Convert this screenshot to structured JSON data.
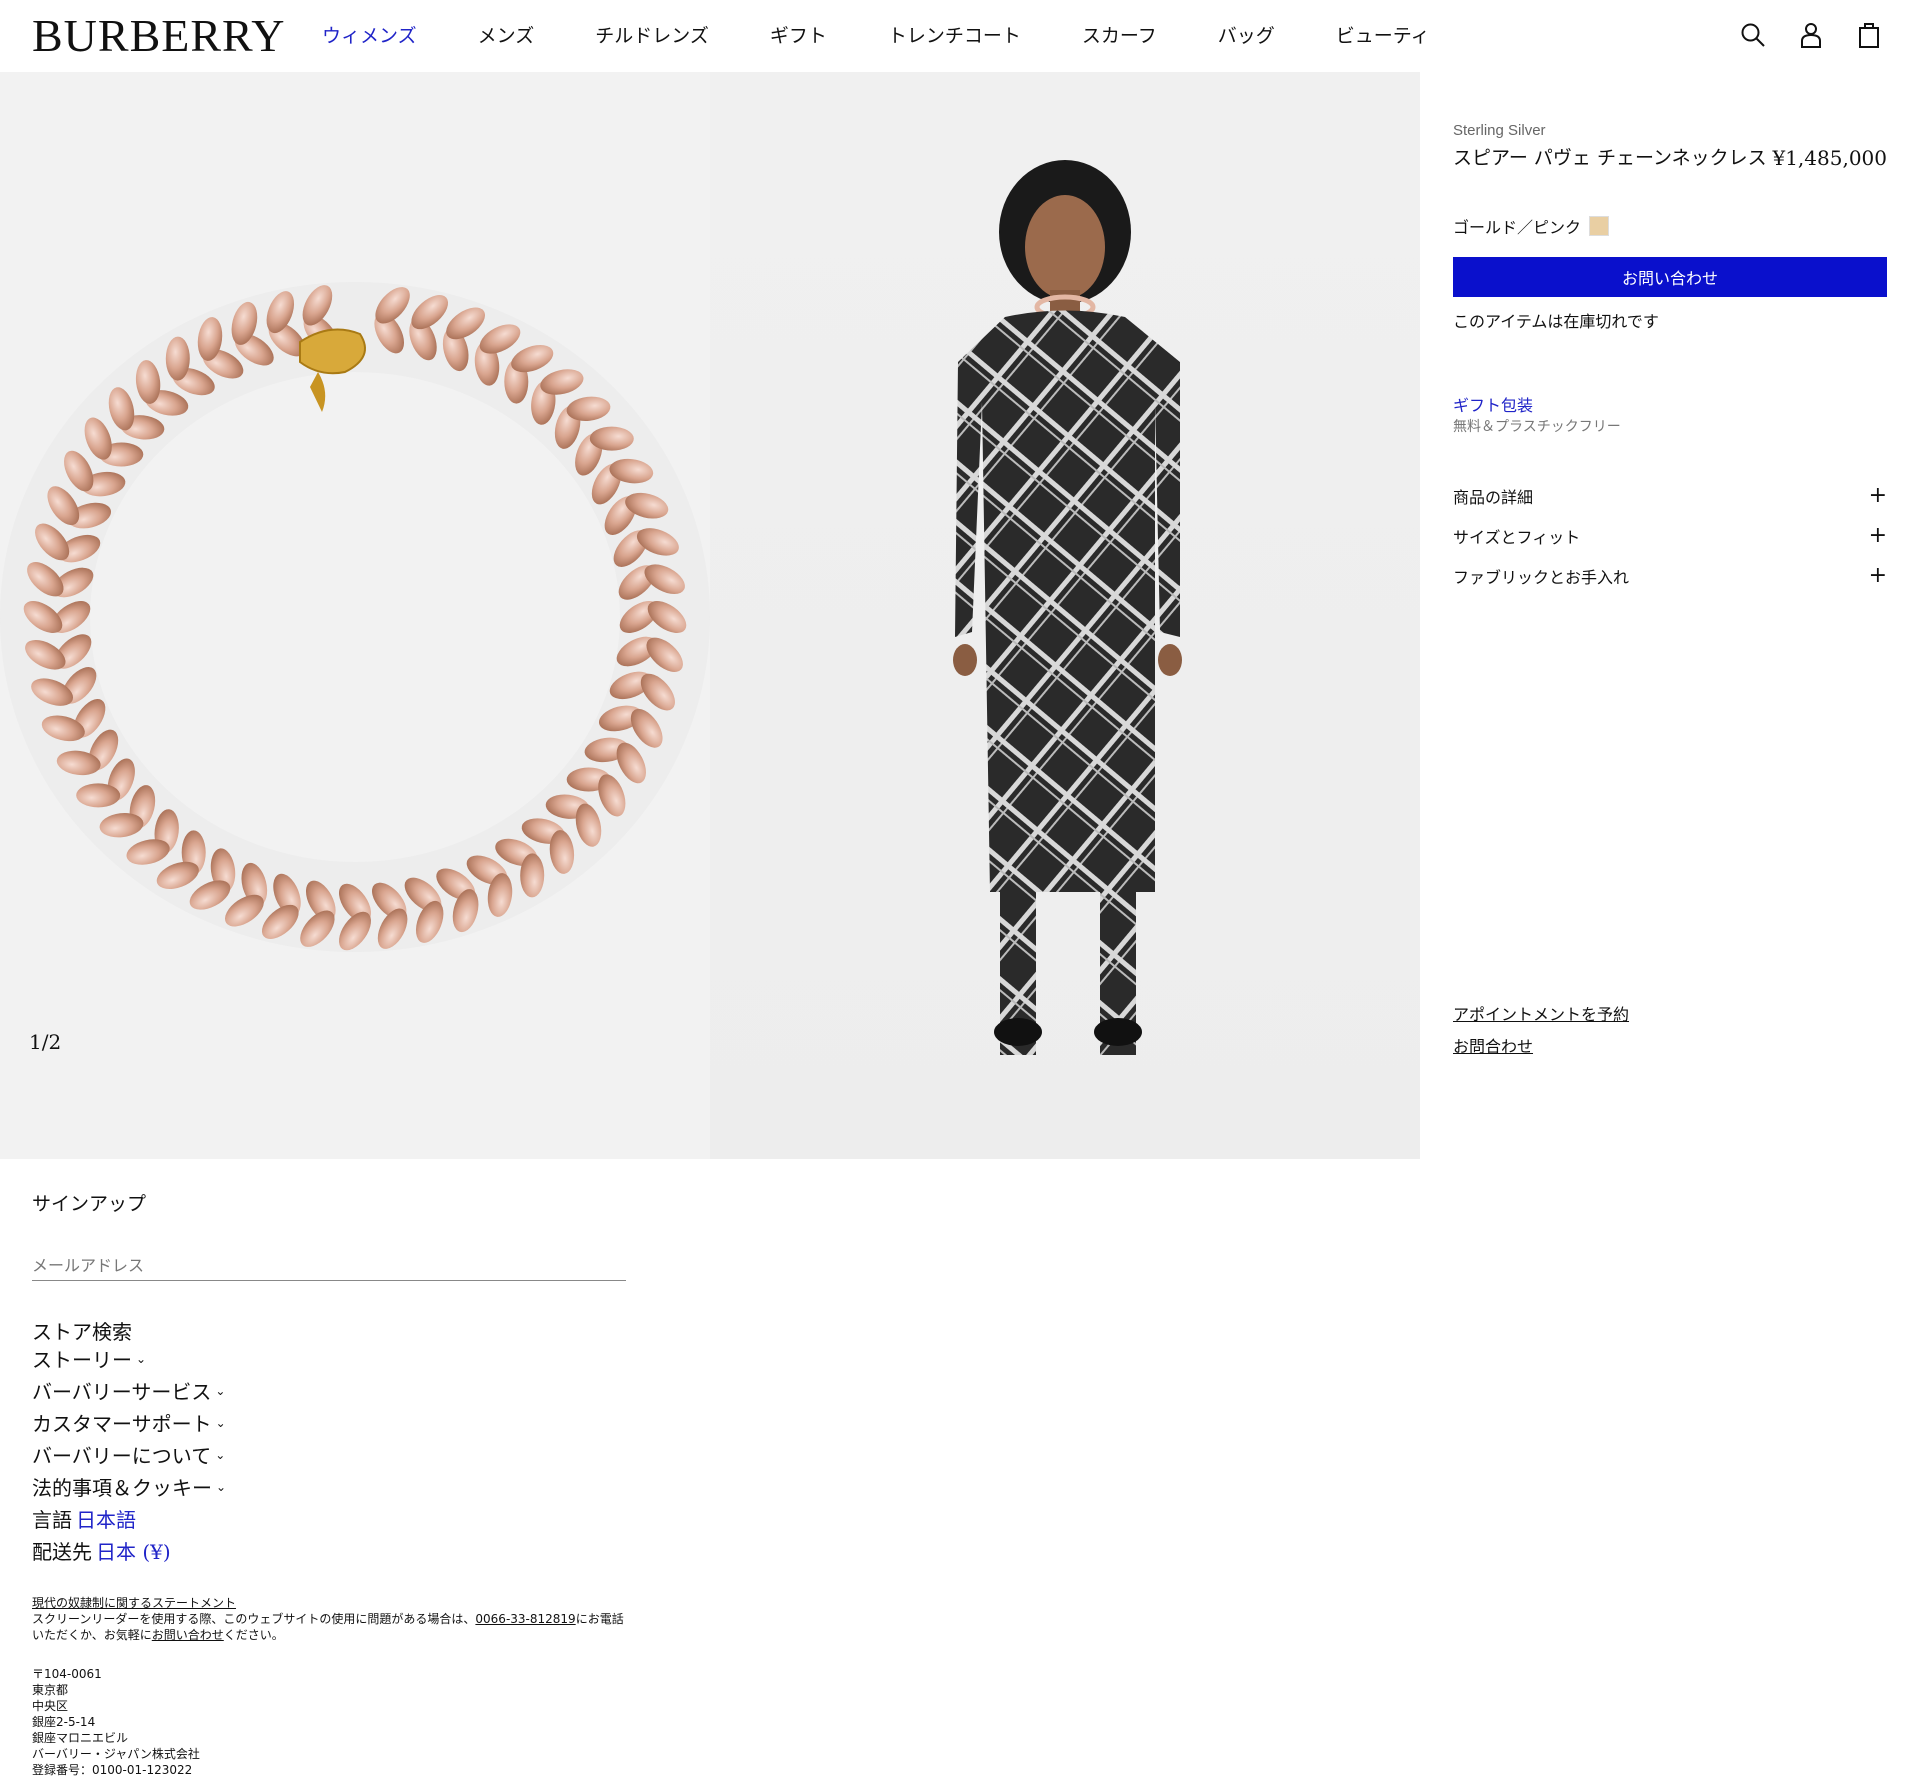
{
  "header": {
    "logo": "BURBERRY",
    "nav": [
      "ウィメンズ",
      "メンズ",
      "チルドレンズ",
      "ギフト",
      "トレンチコート",
      "スカーフ",
      "バッグ",
      "ビューティ"
    ],
    "active_nav": "ウィメンズ",
    "icons": [
      "search-icon",
      "account-icon",
      "bag-icon"
    ]
  },
  "gallery": {
    "counter": "1/2"
  },
  "product": {
    "material": "Sterling Silver",
    "name": "スピアー パヴェ チェーンネックレス",
    "price": "¥1,485,000",
    "color_label": "ゴールド／ピンク",
    "swatch_color": "#e9cfa3",
    "cta_label": "お問い合わせ",
    "stock_status": "このアイテムは在庫切れです",
    "gift_link": "ギフト包装",
    "gift_sub": "無料＆プラスチックフリー",
    "accordions": [
      "商品の詳細",
      "サイズとフィット",
      "ファブリックとお手入れ"
    ],
    "appointment_link": "アポイントメントを予約",
    "contact_link": "お問合わせ"
  },
  "footer": {
    "signup_title": "サインアップ",
    "email_placeholder": "メールアドレス",
    "store_search": "ストア検索",
    "menus": [
      "ストーリー",
      "バーバリーサービス",
      "カスタマーサポート",
      "バーバリーについて",
      "法的事項＆クッキー"
    ],
    "language_label": "言語",
    "language_value": "日本語",
    "ship_label": "配送先",
    "ship_value": "日本 (¥)",
    "slavery_link": "現代の奴隷制に関するステートメント",
    "accessibility_text_1": "スクリーンリーダーを使用する際、このウェブサイトの使用に問題がある場合は、",
    "accessibility_phone": "0066-33-812819",
    "accessibility_text_2": "にお電話",
    "accessibility_text_3": "いただくか、お気軽に",
    "accessibility_contact": "お問い合わせ",
    "accessibility_text_4": "ください。",
    "address": [
      "〒104-0061",
      "東京都",
      "中央区",
      "銀座2-5-14",
      "銀座マロニエビル",
      "バーバリー・ジャパン株式会社",
      "登録番号：0100-01-123022"
    ]
  },
  "colors": {
    "accent": "#0a10cc",
    "link_blue": "#2024c8"
  }
}
